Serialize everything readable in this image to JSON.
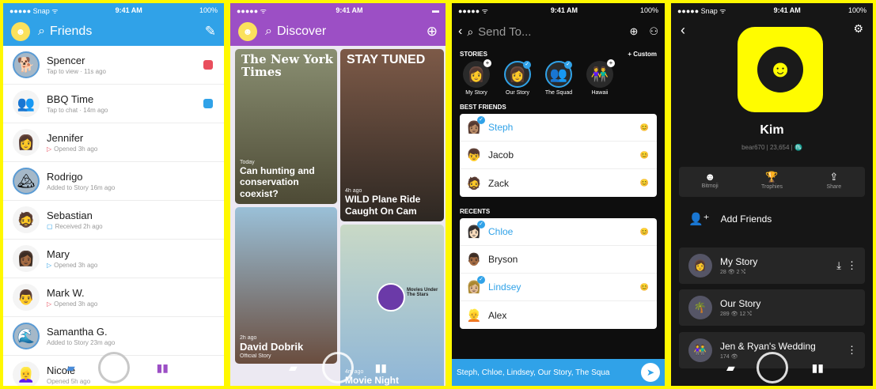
{
  "screen1": {
    "status": {
      "carrier": "●●●●● Snap ᯤ",
      "time": "9:41 AM",
      "battery": "100%"
    },
    "title": "Friends",
    "friends": [
      {
        "name": "Spencer",
        "sub": "Tap to view · 11s ago",
        "badge": "#e94e5d"
      },
      {
        "name": "BBQ Time",
        "sub": "Tap to chat · 14m ago",
        "badge": "#30a2e8"
      },
      {
        "name": "Jennifer",
        "sub": "Opened 3h ago"
      },
      {
        "name": "Rodrigo",
        "sub": "Added to Story 16m ago"
      },
      {
        "name": "Sebastian",
        "sub": "Received 2h ago"
      },
      {
        "name": "Mary",
        "sub": "Opened 3h ago"
      },
      {
        "name": "Mark W.",
        "sub": "Opened 3h ago"
      },
      {
        "name": "Samantha G.",
        "sub": "Added to Story 23m ago"
      },
      {
        "name": "Nicole",
        "sub": "Opened 5h ago"
      }
    ]
  },
  "screen2": {
    "status": {
      "carrier": "●●●●● ᯤ",
      "time": "9:41 AM"
    },
    "title": "Discover",
    "tiles": [
      {
        "pub": "The New York Times",
        "meta": "Today",
        "headline": "Can hunting and conservation coexist?"
      },
      {
        "pub": "STAY TUNED",
        "meta": "4h ago",
        "headline": "WILD Plane Ride Caught On Cam"
      },
      {
        "meta": "2h ago",
        "headline": "David Dobrik",
        "sub": "Official Story"
      },
      {
        "badge": "Movies Under The Stars",
        "meta": "4m ago",
        "headline": "Movie Night"
      }
    ]
  },
  "screen3": {
    "status": {
      "carrier": "●●●●● ᯤ",
      "time": "9:41 AM",
      "battery": "100%"
    },
    "title": "Send To...",
    "stories_title": "STORIES",
    "custom": "+ Custom",
    "stories": [
      "My Story",
      "Our Story",
      "The Squad",
      "Hawaii"
    ],
    "best_title": "BEST FRIENDS",
    "best": [
      "Steph",
      "Jacob",
      "Zack"
    ],
    "recents_title": "RECENTS",
    "recents": [
      "Chloe",
      "Bryson",
      "Lindsey",
      "Alex"
    ],
    "send_text": "Steph, Chloe, Lindsey, Our Story, The Squa"
  },
  "screen4": {
    "status": {
      "carrier": "●●●●● Snap ᯤ",
      "time": "9:41 AM",
      "battery": "100%"
    },
    "name": "Kim",
    "sub": "bear670 | 23,654 | ♏",
    "actions": [
      "Bitmoji",
      "Trophies",
      "Share"
    ],
    "add_friends": "Add Friends",
    "stories": [
      {
        "title": "My Story",
        "sub": "28 👁  2 ⤭"
      },
      {
        "title": "Our Story",
        "sub": "289 👁  12 ⤭"
      },
      {
        "title": "Jen & Ryan's Wedding",
        "sub": "174 👁"
      }
    ]
  }
}
